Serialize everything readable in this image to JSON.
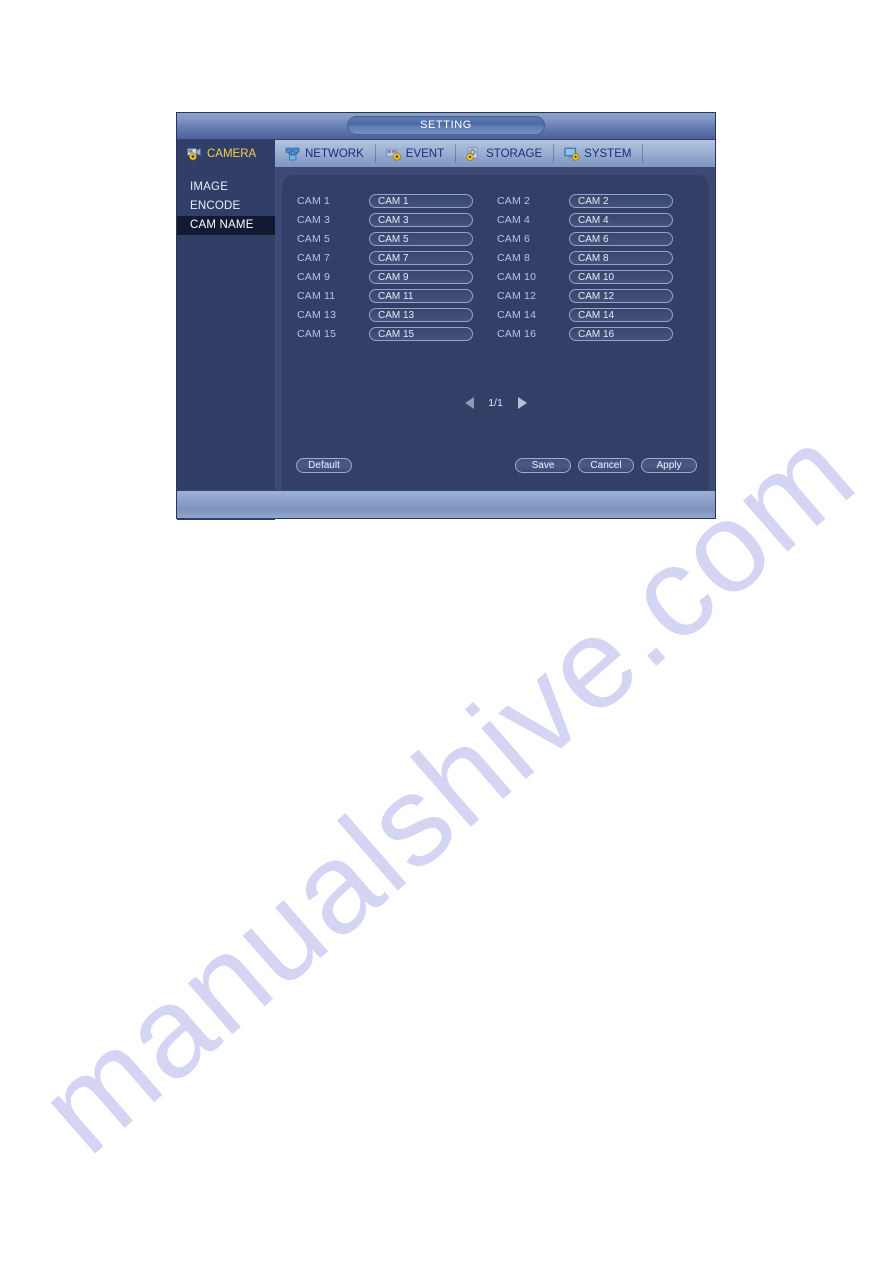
{
  "window": {
    "title": "SETTING"
  },
  "tabs": [
    {
      "label": "CAMERA",
      "icon": "camera-gear-icon",
      "active": true
    },
    {
      "label": "NETWORK",
      "icon": "network-icon",
      "active": false
    },
    {
      "label": "EVENT",
      "icon": "event-gear-icon",
      "active": false
    },
    {
      "label": "STORAGE",
      "icon": "storage-gear-icon",
      "active": false
    },
    {
      "label": "SYSTEM",
      "icon": "system-gear-icon",
      "active": false
    }
  ],
  "sidebar": {
    "items": [
      {
        "label": "IMAGE",
        "selected": false
      },
      {
        "label": "ENCODE",
        "selected": false
      },
      {
        "label": "CAM NAME",
        "selected": true
      }
    ]
  },
  "cameras": [
    {
      "label": "CAM 1",
      "value": "CAM 1"
    },
    {
      "label": "CAM 2",
      "value": "CAM 2"
    },
    {
      "label": "CAM 3",
      "value": "CAM 3"
    },
    {
      "label": "CAM 4",
      "value": "CAM 4"
    },
    {
      "label": "CAM 5",
      "value": "CAM 5"
    },
    {
      "label": "CAM 6",
      "value": "CAM 6"
    },
    {
      "label": "CAM 7",
      "value": "CAM 7"
    },
    {
      "label": "CAM 8",
      "value": "CAM 8"
    },
    {
      "label": "CAM 9",
      "value": "CAM 9"
    },
    {
      "label": "CAM 10",
      "value": "CAM 10"
    },
    {
      "label": "CAM 11",
      "value": "CAM 11"
    },
    {
      "label": "CAM 12",
      "value": "CAM 12"
    },
    {
      "label": "CAM 13",
      "value": "CAM 13"
    },
    {
      "label": "CAM 14",
      "value": "CAM 14"
    },
    {
      "label": "CAM 15",
      "value": "CAM 15"
    },
    {
      "label": "CAM 16",
      "value": "CAM 16"
    }
  ],
  "pagination": {
    "label": "1/1",
    "prev_icon": "triangle-left-icon",
    "next_icon": "triangle-right-icon"
  },
  "buttons": {
    "default_label": "Default",
    "save_label": "Save",
    "cancel_label": "Cancel",
    "apply_label": "Apply"
  },
  "watermark": {
    "text": "manualshive.com"
  },
  "colors": {
    "window_bg": "#3c4a74",
    "panel_bg": "#333f66",
    "sidebar_bg": "#303e68",
    "selected_item_bg": "#121a33",
    "active_tab_text": "#f2d14a",
    "tab_text": "#15307a",
    "label_text": "#b7c4e4",
    "watermark": "#c9c9f0"
  }
}
